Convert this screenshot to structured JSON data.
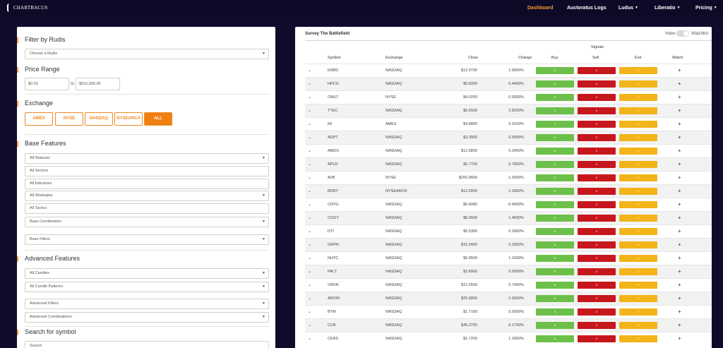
{
  "brand": {
    "name": "CHARTBACUS"
  },
  "nav": [
    {
      "label": "Dashboard",
      "active": true,
      "dropdown": false
    },
    {
      "label": "Auctoratus Logs",
      "active": false,
      "dropdown": false
    },
    {
      "label": "Ludus",
      "active": false,
      "dropdown": true
    },
    {
      "label": "Liberatio",
      "active": false,
      "dropdown": true
    },
    {
      "label": "Pricing",
      "active": false,
      "dropdown": true
    }
  ],
  "filters": {
    "rudis": {
      "title": "Filter by Rudis",
      "select": "Choose a Rudis"
    },
    "price": {
      "title": "Price Range",
      "min": "$0.00",
      "to": "to",
      "max": "$615,000.00"
    },
    "exchange": {
      "title": "Exchange",
      "options": [
        {
          "label": "AMEX",
          "selected": false
        },
        {
          "label": "NYSE",
          "selected": false
        },
        {
          "label": "NASDAQ",
          "selected": false
        },
        {
          "label": "NYSEARCA",
          "selected": false
        },
        {
          "label": "ALL",
          "selected": true
        }
      ]
    },
    "base": {
      "title": "Base Features",
      "fields": [
        {
          "label": "All Statuses",
          "type": "select"
        },
        {
          "label": "All Sectors",
          "type": "input"
        },
        {
          "label": "All Industries",
          "type": "input"
        },
        {
          "label": "All Strategies",
          "type": "select"
        },
        {
          "label": "All Tactics",
          "type": "input"
        },
        {
          "label": "Base Combination",
          "type": "select"
        },
        {
          "label": "Base Filters",
          "type": "select"
        }
      ]
    },
    "advanced": {
      "title": "Advanced Features",
      "fields": [
        {
          "label": "All Candles",
          "type": "select"
        },
        {
          "label": "All Candle Patterns",
          "type": "select"
        },
        {
          "label": "Advanced Filters",
          "type": "select"
        },
        {
          "label": "Advanced Combinations",
          "type": "select"
        }
      ]
    },
    "search": {
      "title": "Search for symbol",
      "placeholder": "Search"
    }
  },
  "table": {
    "title": "Survey The Battlefield",
    "index_label": "Index",
    "watchlist_label": "Watchlist",
    "signals_label": "Signals",
    "columns": [
      "Symbol",
      "Exchange",
      "Close",
      "Change",
      "Buy",
      "Sell",
      "Exit",
      "Watch"
    ],
    "rows": [
      {
        "symbol": "EMBC",
        "exchange": "NASDAQ",
        "close": "$12.0700",
        "change": "1.6800%",
        "buy": "6",
        "sell": "0",
        "exit": "0"
      },
      {
        "symbol": "HPCO",
        "exchange": "NASDAQ",
        "close": "$0.8200",
        "change": "0.4400%",
        "buy": "6",
        "sell": "0",
        "exit": "0"
      },
      {
        "symbol": "OWLT",
        "exchange": "NYSE",
        "close": "$4.0200",
        "change": "0.5000%",
        "buy": "6",
        "sell": "0",
        "exit": "0"
      },
      {
        "symbol": "TTEC",
        "exchange": "NASDAQ",
        "close": "$5.6500",
        "change": "2.8200%",
        "buy": "6",
        "sell": "0",
        "exit": "0"
      },
      {
        "symbol": "MI",
        "exchange": "AMEX",
        "close": "$4.8800",
        "change": "2.3100%",
        "buy": "7",
        "sell": "0",
        "exit": "0"
      },
      {
        "symbol": "ADPT",
        "exchange": "NASDAQ",
        "close": "$3.3900",
        "change": "0.5900%",
        "buy": "6",
        "sell": "0",
        "exit": "0"
      },
      {
        "symbol": "AMDS",
        "exchange": "NASDAQ",
        "close": "$12.5800",
        "change": "0.2400%",
        "buy": "6",
        "sell": "0",
        "exit": "0"
      },
      {
        "symbol": "APLD",
        "exchange": "NASDAQ",
        "close": "$6.7700",
        "change": "6.7800%",
        "buy": "6",
        "sell": "0",
        "exit": "0"
      },
      {
        "symbol": "AVB",
        "exchange": "NYSE",
        "close": "$200.9500",
        "change": "-1.5900%",
        "buy": "6",
        "sell": "0",
        "exit": "0"
      },
      {
        "symbol": "BDRY",
        "exchange": "NYSEARCA",
        "close": "$12.0000",
        "change": "1.1800%",
        "buy": "6",
        "sell": "0",
        "exit": "0"
      },
      {
        "symbol": "CNTG",
        "exchange": "NASDAQ",
        "close": "$0.4080",
        "change": "-0.4900%",
        "buy": "6",
        "sell": "0",
        "exit": "0"
      },
      {
        "symbol": "COGT",
        "exchange": "NASDAQ",
        "close": "$8.3600",
        "change": "1.4600%",
        "buy": "6",
        "sell": "0",
        "exit": "0"
      },
      {
        "symbol": "DTI",
        "exchange": "NASDAQ",
        "close": "$5.5300",
        "change": "0.1800%",
        "buy": "6",
        "sell": "0",
        "exit": "0"
      },
      {
        "symbol": "GRPN",
        "exchange": "NASDAQ",
        "close": "$15.2400",
        "change": "0.3300%",
        "buy": "6",
        "sell": "0",
        "exit": "0"
      },
      {
        "symbol": "NHTC",
        "exchange": "NASDAQ",
        "close": "$6.9500",
        "change": "1.1600%",
        "buy": "6",
        "sell": "0",
        "exit": "0"
      },
      {
        "symbol": "PALT",
        "exchange": "NASDAQ",
        "close": "$3.8900",
        "change": "0.0000%",
        "buy": "6",
        "sell": "0",
        "exit": "0"
      },
      {
        "symbol": "VRDN",
        "exchange": "NASDAQ",
        "close": "$12.2500",
        "change": "0.7400%",
        "buy": "6",
        "sell": "0",
        "exit": "0"
      },
      {
        "symbol": "AROW",
        "exchange": "NASDAQ",
        "close": "$25.6800",
        "change": "-1.6500%",
        "buy": "6",
        "sell": "0",
        "exit": "0"
      },
      {
        "symbol": "BTM",
        "exchange": "NASDAQ",
        "close": "$1.7100",
        "change": "5.5600%",
        "buy": "5",
        "sell": "0",
        "exit": "0"
      },
      {
        "symbol": "CCB",
        "exchange": "NASDAQ",
        "close": "$45.2700",
        "change": "-3.1700%",
        "buy": "5",
        "sell": "0",
        "exit": "0"
      },
      {
        "symbol": "CERS",
        "exchange": "NASDAQ",
        "close": "$1.7200",
        "change": "1.1800%",
        "buy": "5",
        "sell": "0",
        "exit": "0"
      }
    ]
  },
  "colors": {
    "background": "#0e0b2b",
    "accent": "#f07f11",
    "buy": "#6cc04a",
    "sell": "#c8161d",
    "exit": "#f2b418"
  },
  "icons": {
    "expand": "chevron-down-icon",
    "watch": "plus-icon",
    "select": "caret-down-icon"
  }
}
